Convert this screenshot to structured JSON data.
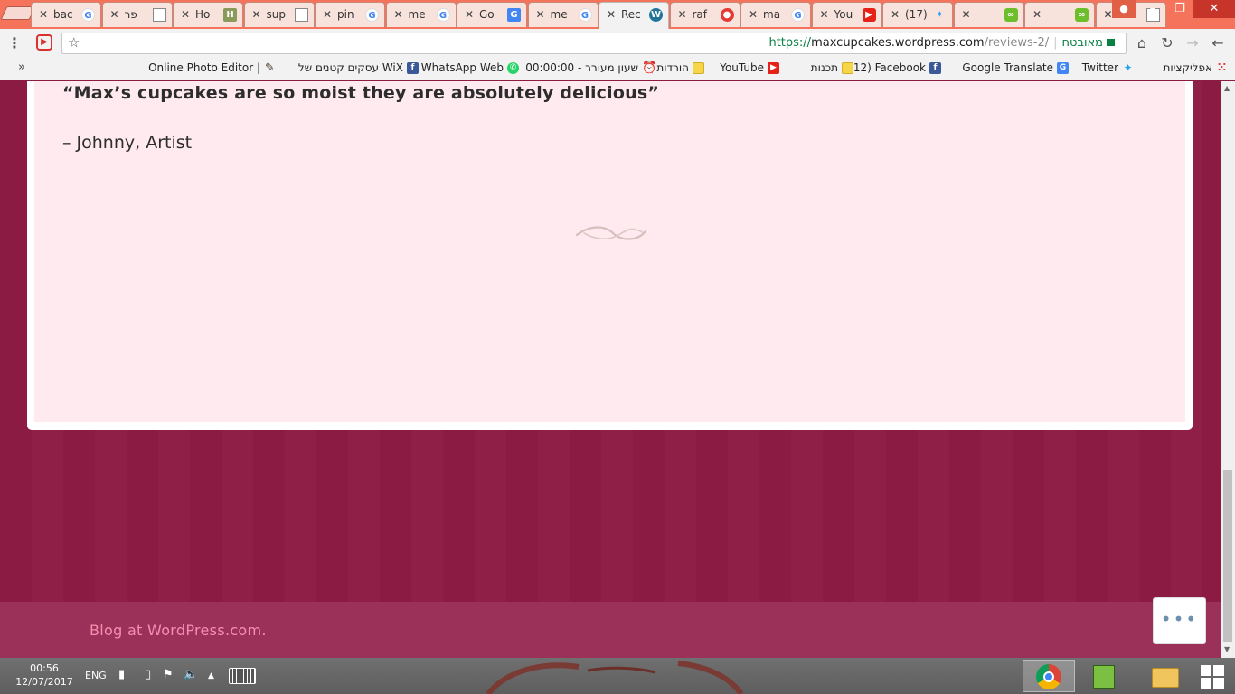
{
  "browser": {
    "tabs": [
      {
        "title": "bac",
        "favicon": "google-icon"
      },
      {
        "title": "פר",
        "favicon": "document-icon"
      },
      {
        "title": "Ho",
        "favicon": "wikihow-icon"
      },
      {
        "title": "sup",
        "favicon": "document-icon"
      },
      {
        "title": "pin",
        "favicon": "google-icon"
      },
      {
        "title": "me",
        "favicon": "google-icon"
      },
      {
        "title": "Go",
        "favicon": "google-translate-icon"
      },
      {
        "title": "me",
        "favicon": "google-icon"
      },
      {
        "title": "Rec",
        "favicon": "wordpress-icon",
        "active": true
      },
      {
        "title": "raf",
        "favicon": "red-app-icon"
      },
      {
        "title": "ma",
        "favicon": "google-icon"
      },
      {
        "title": "You",
        "favicon": "youtube-icon"
      },
      {
        "title": "(17)",
        "favicon": "twitter-icon"
      },
      {
        "title": "",
        "favicon": "green-app-icon"
      },
      {
        "title": "",
        "favicon": "green-app-icon"
      },
      {
        "title": "",
        "favicon": "document-icon"
      }
    ],
    "address": {
      "secure_label": "מאובטח",
      "scheme": "https://",
      "host": "maxcupcakes.wordpress.com",
      "path": "/reviews-2/"
    },
    "bookmarks": [
      {
        "label": "אפליקציות",
        "icon": "apps-icon"
      },
      {
        "label": "Twitter",
        "icon": "twitter-icon"
      },
      {
        "label": "Google Translate",
        "icon": "google-translate-icon"
      },
      {
        "label": "(12) Facebook",
        "icon": "facebook-icon"
      },
      {
        "label": "תכנות",
        "icon": "folder-icon"
      },
      {
        "label": "YouTube",
        "icon": "youtube-icon"
      },
      {
        "label": "הורדות",
        "icon": "folder-icon"
      },
      {
        "label": "00:00:00 - שעון מעורר",
        "icon": "alarm-icon"
      },
      {
        "label": "WhatsApp Web",
        "icon": "whatsapp-icon"
      },
      {
        "label": "עסקים קטנים של WiX",
        "icon": "facebook-icon"
      },
      {
        "label": "Online Photo Editor |",
        "icon": "pen-icon"
      }
    ],
    "bookmarks_more": "»"
  },
  "page": {
    "quote": "“Max’s cupcakes are so moist they are absolutely delicious”",
    "attribution": "– Johnny, Artist",
    "footer_link": "Blog at WordPress.com.",
    "more_button": "•••"
  },
  "taskbar": {
    "time": "00:56",
    "date": "12/07/2017",
    "language": "ENG",
    "apps": [
      "chrome",
      "notepad",
      "file-explorer"
    ]
  },
  "colors": {
    "tab_strip": "#f4735a",
    "page_bg": "#8b1b42",
    "card_bg": "#ffeaf0",
    "footer_link": "#f48fb1",
    "secure_green": "#0a8043"
  }
}
